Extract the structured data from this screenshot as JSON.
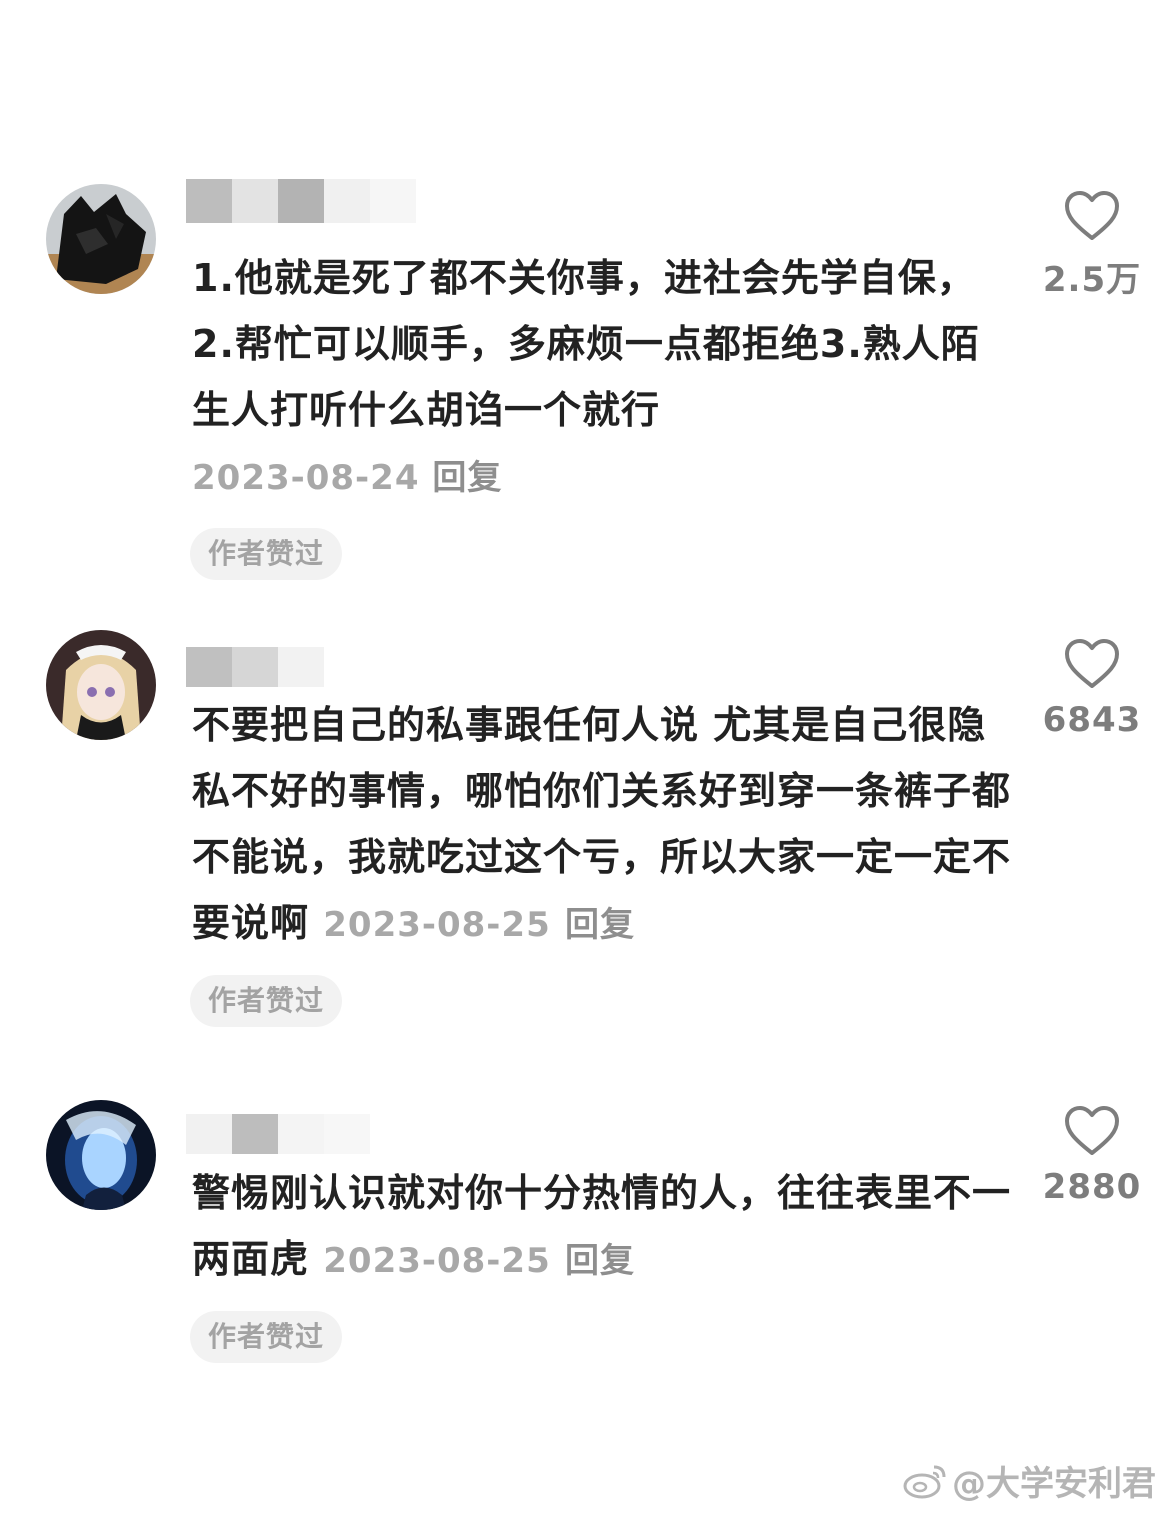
{
  "comments": [
    {
      "text": "1.他就是死了都不关你事，进社会先学自保，2.帮忙可以顺手，多麻烦一点都拒绝3.熟人陌生人打听什么胡诌一个就行",
      "date": "2023-08-24",
      "reply_label": "回复",
      "author_liked_label": "作者赞过",
      "like_count": "2.5万",
      "avatar_icon": "black-cat-avatar"
    },
    {
      "text": "不要把自己的私事跟任何人说 尤其是自己很隐私不好的事情，哪怕你们关系好到穿一条裤子都不能说，我就吃过这个亏，所以大家一定一定不要说啊",
      "date": "2023-08-25",
      "reply_label": "回复",
      "author_liked_label": "作者赞过",
      "like_count": "6843",
      "avatar_icon": "anime-girl-avatar"
    },
    {
      "text": "警惕刚认识就对你十分热情的人，往往表里不一两面虎",
      "date": "2023-08-25",
      "reply_label": "回复",
      "author_liked_label": "作者赞过",
      "like_count": "2880",
      "avatar_icon": "blue-glow-avatar"
    }
  ],
  "watermark": {
    "text": "@大学安利君",
    "icon": "weibo-icon"
  },
  "icons": {
    "like": "heart-icon"
  }
}
